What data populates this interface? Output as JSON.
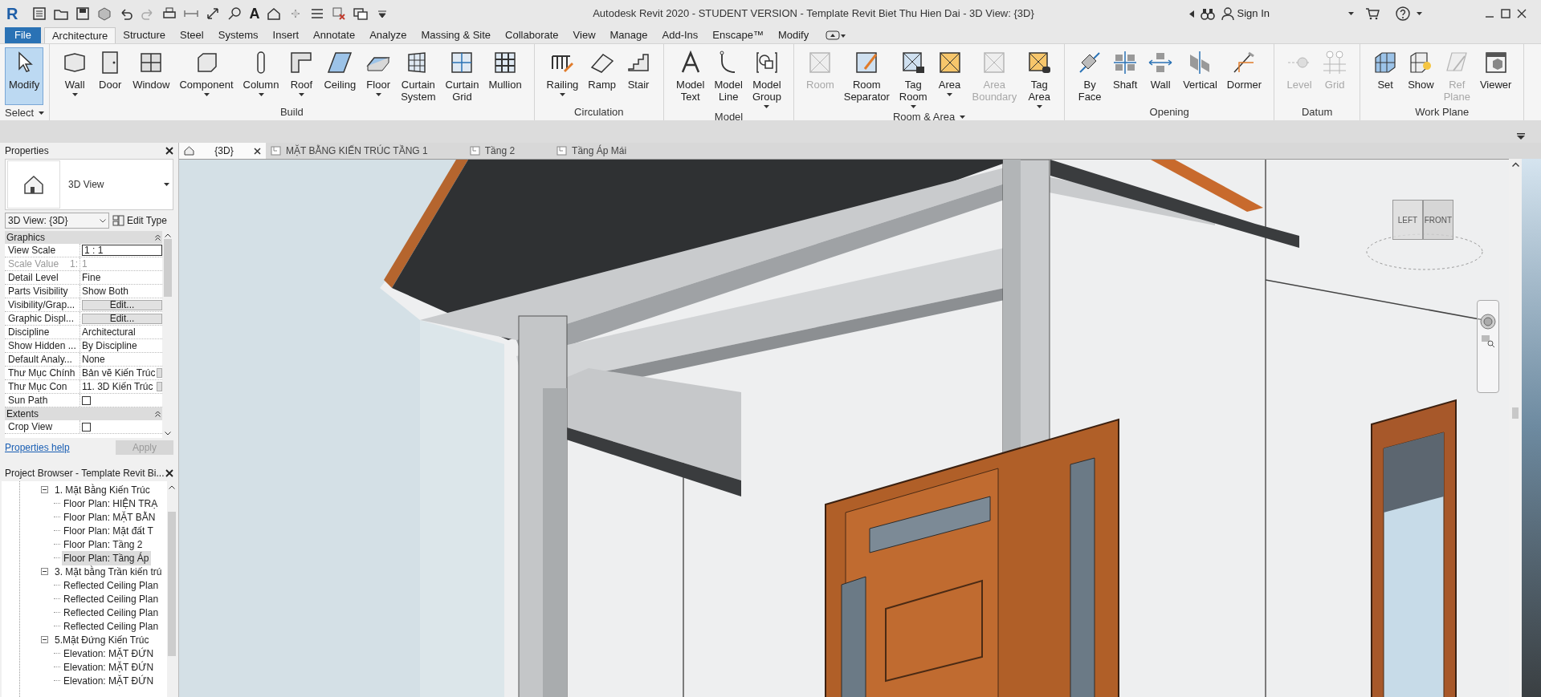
{
  "window": {
    "title": "Autodesk Revit 2020 - STUDENT VERSION - Template Revit Biet Thu Hien Dai - 3D View: {3D}",
    "app_logo": "R",
    "text_tool": "A",
    "sign_in": "Sign In"
  },
  "menu_tabs": [
    {
      "label": "File",
      "kind": "application",
      "selected": false
    },
    {
      "label": "Architecture",
      "kind": "tab",
      "selected": true
    },
    {
      "label": "Structure",
      "kind": "tab",
      "selected": false
    },
    {
      "label": "Steel",
      "kind": "tab",
      "selected": false
    },
    {
      "label": "Systems",
      "kind": "tab",
      "selected": false
    },
    {
      "label": "Insert",
      "kind": "tab",
      "selected": false
    },
    {
      "label": "Annotate",
      "kind": "tab",
      "selected": false
    },
    {
      "label": "Analyze",
      "kind": "tab",
      "selected": false
    },
    {
      "label": "Massing & Site",
      "kind": "tab",
      "selected": false
    },
    {
      "label": "Collaborate",
      "kind": "tab",
      "selected": false
    },
    {
      "label": "View",
      "kind": "tab",
      "selected": false
    },
    {
      "label": "Manage",
      "kind": "tab",
      "selected": false
    },
    {
      "label": "Add-Ins",
      "kind": "tab",
      "selected": false
    },
    {
      "label": "Enscape™",
      "kind": "tab",
      "selected": false
    },
    {
      "label": "Modify",
      "kind": "tab",
      "selected": false
    }
  ],
  "ribbon_panels": [
    {
      "title": "Select",
      "menu": true,
      "tools": [
        {
          "label": "Modify",
          "dropdown": false,
          "disabled": false,
          "selected": true
        }
      ]
    },
    {
      "title": "Build",
      "menu": false,
      "tools": [
        {
          "label": "Wall",
          "dropdown": true,
          "disabled": false,
          "selected": false
        },
        {
          "label": "Door",
          "dropdown": false,
          "disabled": false,
          "selected": false
        },
        {
          "label": "Window",
          "dropdown": false,
          "disabled": false,
          "selected": false
        },
        {
          "label": "Component",
          "dropdown": true,
          "disabled": false,
          "selected": false
        },
        {
          "label": "Column",
          "dropdown": true,
          "disabled": false,
          "selected": false
        },
        {
          "label": "Roof",
          "dropdown": true,
          "disabled": false,
          "selected": false
        },
        {
          "label": "Ceiling",
          "dropdown": false,
          "disabled": false,
          "selected": false
        },
        {
          "label": "Floor",
          "dropdown": true,
          "disabled": false,
          "selected": false
        },
        {
          "label": "Curtain\nSystem",
          "dropdown": false,
          "disabled": false,
          "selected": false
        },
        {
          "label": "Curtain\nGrid",
          "dropdown": false,
          "disabled": false,
          "selected": false
        },
        {
          "label": "Mullion",
          "dropdown": false,
          "disabled": false,
          "selected": false
        }
      ]
    },
    {
      "title": "Circulation",
      "menu": false,
      "tools": [
        {
          "label": "Railing",
          "dropdown": true,
          "disabled": false,
          "selected": false
        },
        {
          "label": "Ramp",
          "dropdown": false,
          "disabled": false,
          "selected": false
        },
        {
          "label": "Stair",
          "dropdown": false,
          "disabled": false,
          "selected": false
        }
      ]
    },
    {
      "title": "Model",
      "menu": false,
      "tools": [
        {
          "label": "Model\nText",
          "dropdown": false,
          "disabled": false,
          "selected": false
        },
        {
          "label": "Model\nLine",
          "dropdown": false,
          "disabled": false,
          "selected": false
        },
        {
          "label": "Model\nGroup",
          "dropdown": true,
          "disabled": false,
          "selected": false
        }
      ]
    },
    {
      "title": "Room & Area",
      "menu": true,
      "tools": [
        {
          "label": "Room",
          "dropdown": false,
          "disabled": true,
          "selected": false
        },
        {
          "label": "Room\nSeparator",
          "dropdown": false,
          "disabled": false,
          "selected": false
        },
        {
          "label": "Tag\nRoom",
          "dropdown": true,
          "disabled": false,
          "selected": false
        },
        {
          "label": "Area",
          "dropdown": true,
          "disabled": false,
          "selected": false
        },
        {
          "label": "Area\nBoundary",
          "dropdown": false,
          "disabled": true,
          "selected": false
        },
        {
          "label": "Tag\nArea",
          "dropdown": true,
          "disabled": false,
          "selected": false
        }
      ]
    },
    {
      "title": "Opening",
      "menu": false,
      "tools": [
        {
          "label": "By\nFace",
          "dropdown": false,
          "disabled": false,
          "selected": false
        },
        {
          "label": "Shaft",
          "dropdown": false,
          "disabled": false,
          "selected": false
        },
        {
          "label": "Wall",
          "dropdown": false,
          "disabled": false,
          "selected": false
        },
        {
          "label": "Vertical",
          "dropdown": false,
          "disabled": false,
          "selected": false
        },
        {
          "label": "Dormer",
          "dropdown": false,
          "disabled": false,
          "selected": false
        }
      ]
    },
    {
      "title": "Datum",
      "menu": false,
      "tools": [
        {
          "label": "Level",
          "dropdown": false,
          "disabled": true,
          "selected": false
        },
        {
          "label": "Grid",
          "dropdown": false,
          "disabled": true,
          "selected": false
        }
      ]
    },
    {
      "title": "Work Plane",
      "menu": false,
      "tools": [
        {
          "label": "Set",
          "dropdown": false,
          "disabled": false,
          "selected": false
        },
        {
          "label": "Show",
          "dropdown": false,
          "disabled": false,
          "selected": false
        },
        {
          "label": "Ref\nPlane",
          "dropdown": false,
          "disabled": true,
          "selected": false
        },
        {
          "label": "Viewer",
          "dropdown": false,
          "disabled": false,
          "selected": false
        }
      ]
    }
  ],
  "view_tabs": [
    {
      "label": "{3D}",
      "selected": true
    },
    {
      "label": "MẶT BẰNG KIẾN TRÚC TẦNG 1",
      "selected": false
    },
    {
      "label": "Tầng 2",
      "selected": false
    },
    {
      "label": "Tầng Áp Mái",
      "selected": false
    }
  ],
  "properties": {
    "title": "Properties",
    "type_name": "3D View",
    "selector": "3D View: {3D}",
    "edit_type": "Edit Type",
    "groups": [
      {
        "title": "Graphics",
        "rows": [
          {
            "label": "View Scale",
            "value": "1 : 1",
            "kind": "input",
            "disabled": false
          },
          {
            "label": "Scale Value",
            "suffix": "1:",
            "value": "1",
            "kind": "text",
            "disabled": true
          },
          {
            "label": "Detail Level",
            "value": "Fine",
            "kind": "text",
            "disabled": false
          },
          {
            "label": "Parts Visibility",
            "value": "Show Both",
            "kind": "text",
            "disabled": false
          },
          {
            "label": "Visibility/Grap...",
            "value": "Edit...",
            "kind": "button",
            "disabled": false
          },
          {
            "label": "Graphic Displ...",
            "value": "Edit...",
            "kind": "button",
            "disabled": false
          },
          {
            "label": "Discipline",
            "value": "Architectural",
            "kind": "text",
            "disabled": false
          },
          {
            "label": "Show Hidden ...",
            "value": "By Discipline",
            "kind": "text",
            "disabled": false
          },
          {
            "label": "Default Analy...",
            "value": "None",
            "kind": "text",
            "disabled": false
          },
          {
            "label": "Thư Mục Chính",
            "value": "Bản vẽ Kiến Trúc",
            "kind": "browse",
            "disabled": false
          },
          {
            "label": "Thư Mục Con",
            "value": "11. 3D Kiến Trúc",
            "kind": "browse",
            "disabled": false
          },
          {
            "label": "Sun Path",
            "checked": false,
            "kind": "checkbox",
            "disabled": false
          }
        ]
      },
      {
        "title": "Extents",
        "rows": [
          {
            "label": "Crop View",
            "checked": false,
            "kind": "checkbox",
            "disabled": false
          }
        ]
      }
    ],
    "help_link": "Properties help",
    "apply": {
      "label": "Apply",
      "disabled": true
    }
  },
  "project_browser": {
    "title": "Project Browser - Template Revit Bi...",
    "tree": [
      {
        "label": "1. Mặt Bằng Kiến Trúc",
        "expanded": true,
        "children": [
          {
            "label": "Floor Plan: HIỆN TRẠ",
            "selected": false
          },
          {
            "label": "Floor Plan: MẶT BẰN",
            "selected": false
          },
          {
            "label": "Floor Plan: Mặt đất T",
            "selected": false
          },
          {
            "label": "Floor Plan: Tầng 2",
            "selected": false
          },
          {
            "label": "Floor Plan: Tầng Áp",
            "selected": true
          }
        ]
      },
      {
        "label": "3. Mặt bằng Trần kiến trú",
        "expanded": true,
        "children": [
          {
            "label": "Reflected Ceiling Plan",
            "selected": false
          },
          {
            "label": "Reflected Ceiling Plan",
            "selected": false
          },
          {
            "label": "Reflected Ceiling Plan",
            "selected": false
          },
          {
            "label": "Reflected Ceiling Plan",
            "selected": false
          }
        ]
      },
      {
        "label": "5.Mặt Đứng Kiến Trúc",
        "expanded": true,
        "children": [
          {
            "label": "Elevation: MẶT ĐỨN",
            "selected": false
          },
          {
            "label": "Elevation: MẶT ĐỨN",
            "selected": false
          },
          {
            "label": "Elevation: MẶT ĐỨN",
            "selected": false
          }
        ]
      }
    ]
  },
  "viewcube": {
    "left": "LEFT",
    "front": "FRONT"
  }
}
